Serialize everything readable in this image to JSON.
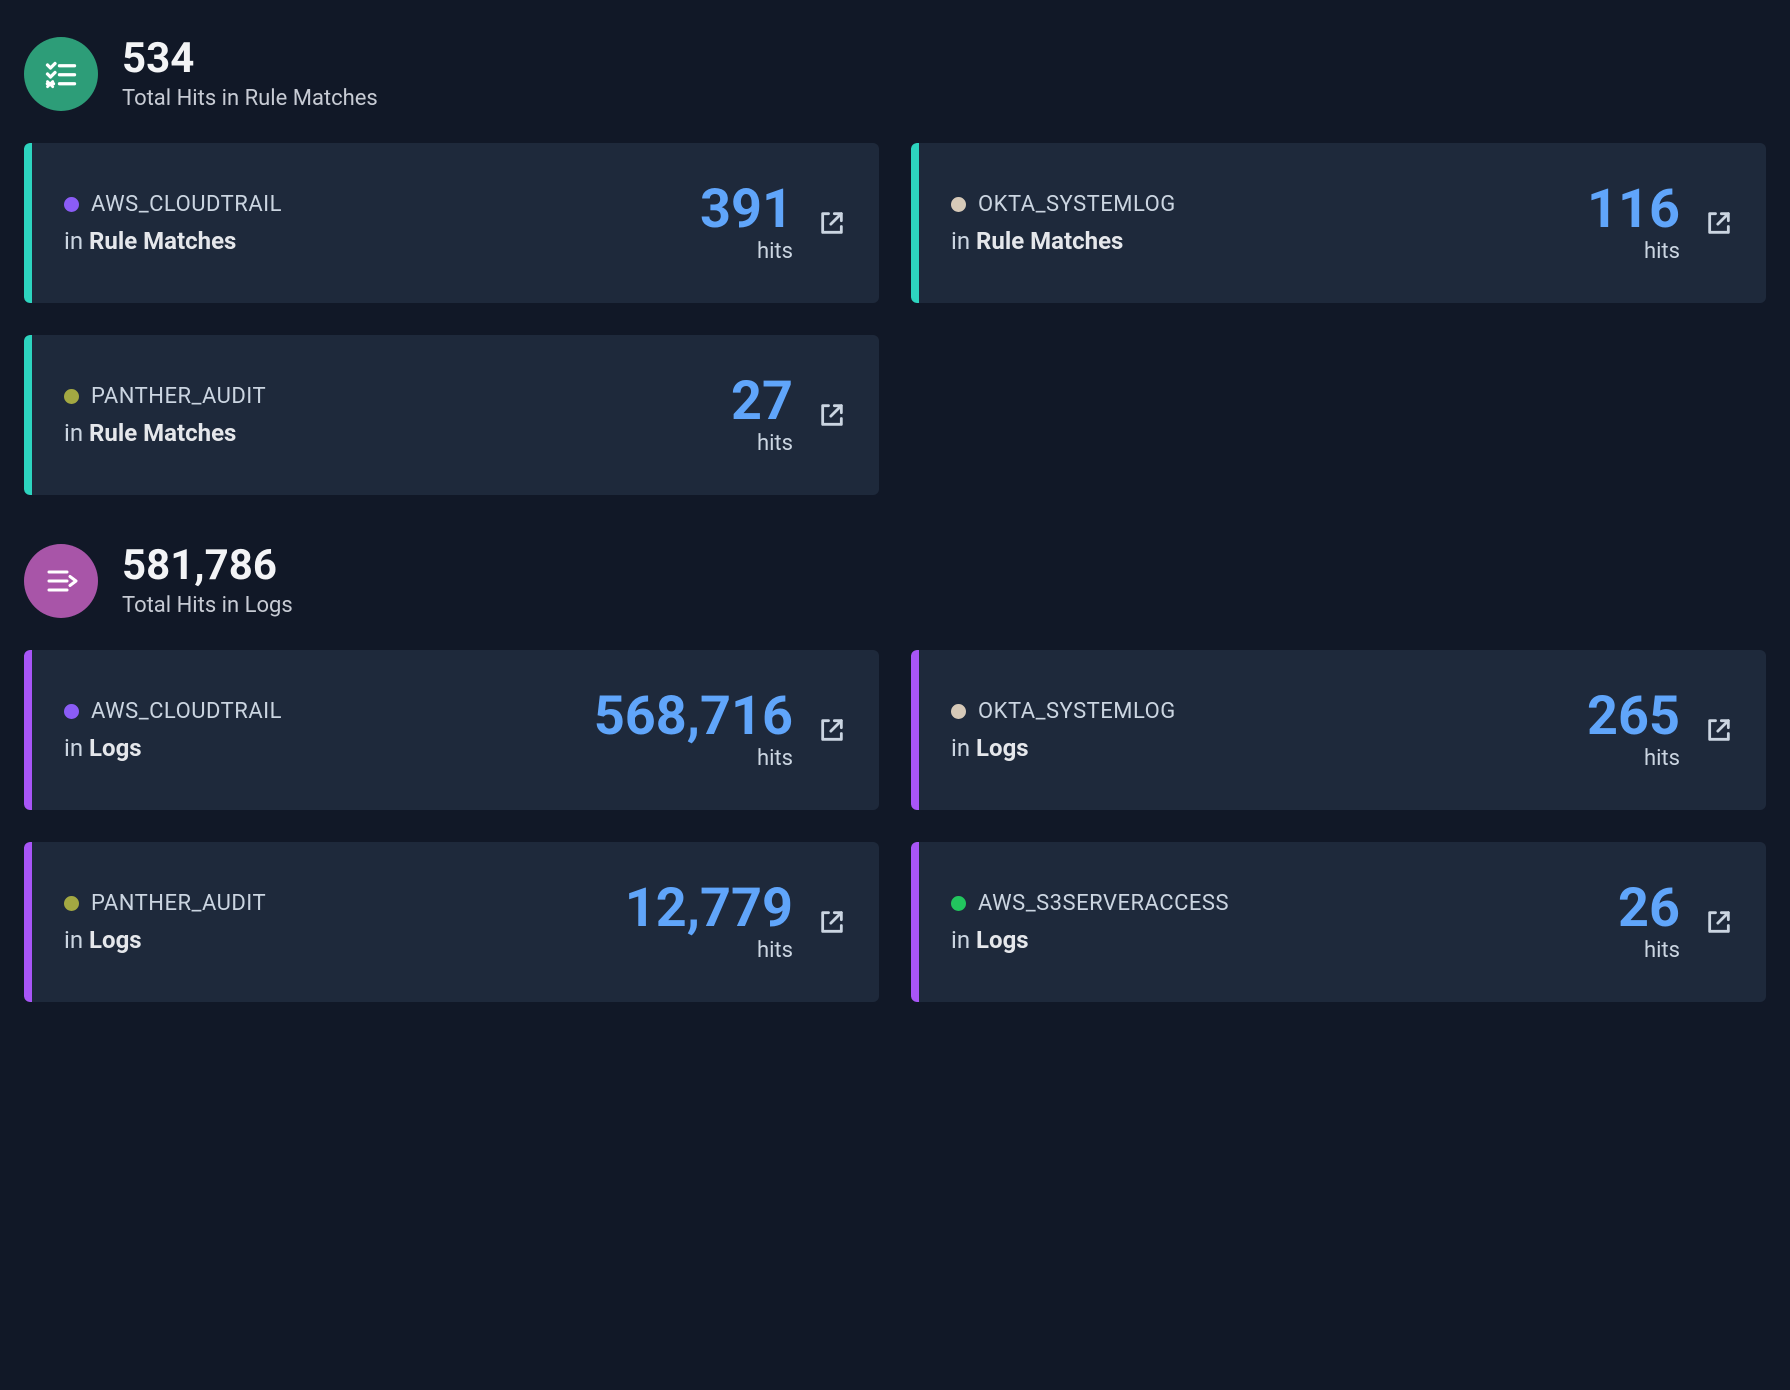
{
  "sections": [
    {
      "id": "rulematches",
      "icon": "checklist",
      "icon_color": "teal",
      "accent": "teal",
      "total": "534",
      "subtitle": "Total Hits in Rule Matches",
      "context_prefix": "in ",
      "context_bold": "Rule Matches",
      "cards": [
        {
          "source": "AWS_CLOUDTRAIL",
          "dot": "dot-purple",
          "hits": "391",
          "hits_label": "hits"
        },
        {
          "source": "OKTA_SYSTEMLOG",
          "dot": "dot-beige",
          "hits": "116",
          "hits_label": "hits"
        },
        {
          "source": "PANTHER_AUDIT",
          "dot": "dot-olive",
          "hits": "27",
          "hits_label": "hits"
        }
      ]
    },
    {
      "id": "logs",
      "icon": "logs",
      "icon_color": "purple",
      "accent": "purple",
      "total": "581,786",
      "subtitle": "Total Hits in Logs",
      "context_prefix": "in ",
      "context_bold": "Logs",
      "cards": [
        {
          "source": "AWS_CLOUDTRAIL",
          "dot": "dot-purple",
          "hits": "568,716",
          "hits_label": "hits"
        },
        {
          "source": "OKTA_SYSTEMLOG",
          "dot": "dot-beige",
          "hits": "265",
          "hits_label": "hits"
        },
        {
          "source": "PANTHER_AUDIT",
          "dot": "dot-olive",
          "hits": "12,779",
          "hits_label": "hits"
        },
        {
          "source": "AWS_S3SERVERACCESS",
          "dot": "dot-green",
          "hits": "26",
          "hits_label": "hits"
        }
      ]
    }
  ]
}
